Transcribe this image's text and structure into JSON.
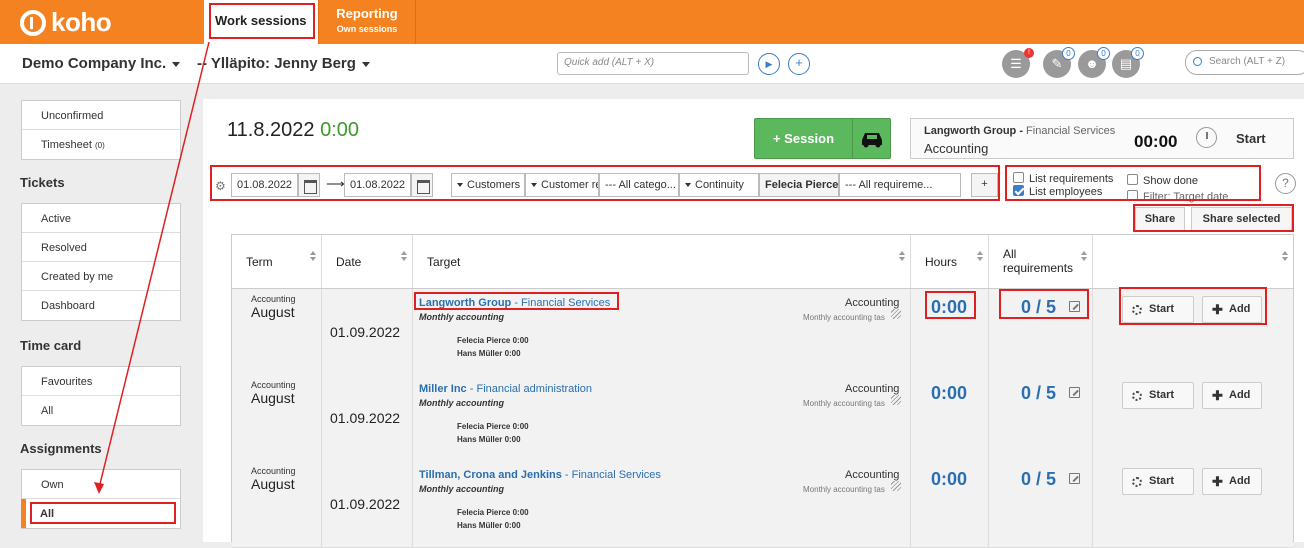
{
  "app": {
    "logo_text": "koho",
    "accent": "#f58220"
  },
  "tabs": [
    {
      "label": "Work sessions"
    },
    {
      "label": "Reporting",
      "sub": "Own sessions"
    }
  ],
  "header": {
    "company": "Demo Company Inc.",
    "admin": "-- Ylläpito: Jenny Berg",
    "quick_add_placeholder": "Quick add (ALT + X)",
    "search_placeholder": "Search (ALT + Z)",
    "badges": [
      "0",
      "0",
      "0"
    ]
  },
  "sidebar": {
    "group1": [
      {
        "label": "Unconfirmed"
      },
      {
        "label": "Timesheet",
        "count": "(0)"
      }
    ],
    "tickets_title": "Tickets",
    "tickets": [
      {
        "label": "Active"
      },
      {
        "label": "Resolved"
      },
      {
        "label": "Created by me"
      },
      {
        "label": "Dashboard"
      }
    ],
    "timecard_title": "Time card",
    "timecard": [
      {
        "label": "Favourites"
      },
      {
        "label": "All"
      }
    ],
    "assignments_title": "Assignments",
    "assignments": [
      {
        "label": "Own"
      },
      {
        "label": "All"
      }
    ]
  },
  "main": {
    "date": "11.8.2022",
    "total": "0:00",
    "session_button": "+ Session",
    "timer": {
      "customer": "Langworth Group",
      "service": "Financial Services",
      "task": "Accounting",
      "time": "00:00",
      "start": "Start"
    }
  },
  "filters": {
    "date_from": "01.08.2022",
    "date_to": "01.08.2022",
    "customers": "Customers",
    "customer_re": "Customer re",
    "all_categories": "--- All catego...",
    "continuity": "Continuity",
    "employee": "Felecia Pierce",
    "all_requirements": "--- All requireme...",
    "add": "+",
    "list_requirements": "List requirements",
    "list_employees": "List employees",
    "show_done": "Show done",
    "filter_target_date": "Filter: Target date",
    "help": "?"
  },
  "share": {
    "share": "Share",
    "share_selected": "Share selected"
  },
  "table": {
    "headers": {
      "term": "Term",
      "date": "Date",
      "target": "Target",
      "hours": "Hours",
      "requirements": "All requirements"
    },
    "rows": [
      {
        "term_small": "Accounting",
        "term": "August",
        "date": "01.09.2022",
        "customer": "Langworth Group",
        "service": "Financial Services",
        "subtitle": "Monthly accounting",
        "employees": [
          "Felecia Pierce 0:00",
          "Hans Müller 0:00"
        ],
        "account": "Accounting",
        "account_sub": "Monthly accounting tas",
        "hours": "0:00",
        "reqs": "0 / 5",
        "start": "Start",
        "add": "Add"
      },
      {
        "term_small": "Accounting",
        "term": "August",
        "date": "01.09.2022",
        "customer": "Miller Inc",
        "service": "Financial administration",
        "subtitle": "Monthly accounting",
        "employees": [
          "Felecia Pierce 0:00",
          "Hans Müller 0:00"
        ],
        "account": "Accounting",
        "account_sub": "Monthly accounting tas",
        "hours": "0:00",
        "reqs": "0 / 5",
        "start": "Start",
        "add": "Add"
      },
      {
        "term_small": "Accounting",
        "term": "August",
        "date": "01.09.2022",
        "customer": "Tillman, Crona and Jenkins",
        "service": "Financial Services",
        "subtitle": "Monthly accounting",
        "employees": [
          "Felecia Pierce 0:00",
          "Hans Müller 0:00"
        ],
        "account": "Accounting",
        "account_sub": "Monthly accounting tas",
        "hours": "0:00",
        "reqs": "0 / 5",
        "start": "Start",
        "add": "Add"
      }
    ]
  }
}
